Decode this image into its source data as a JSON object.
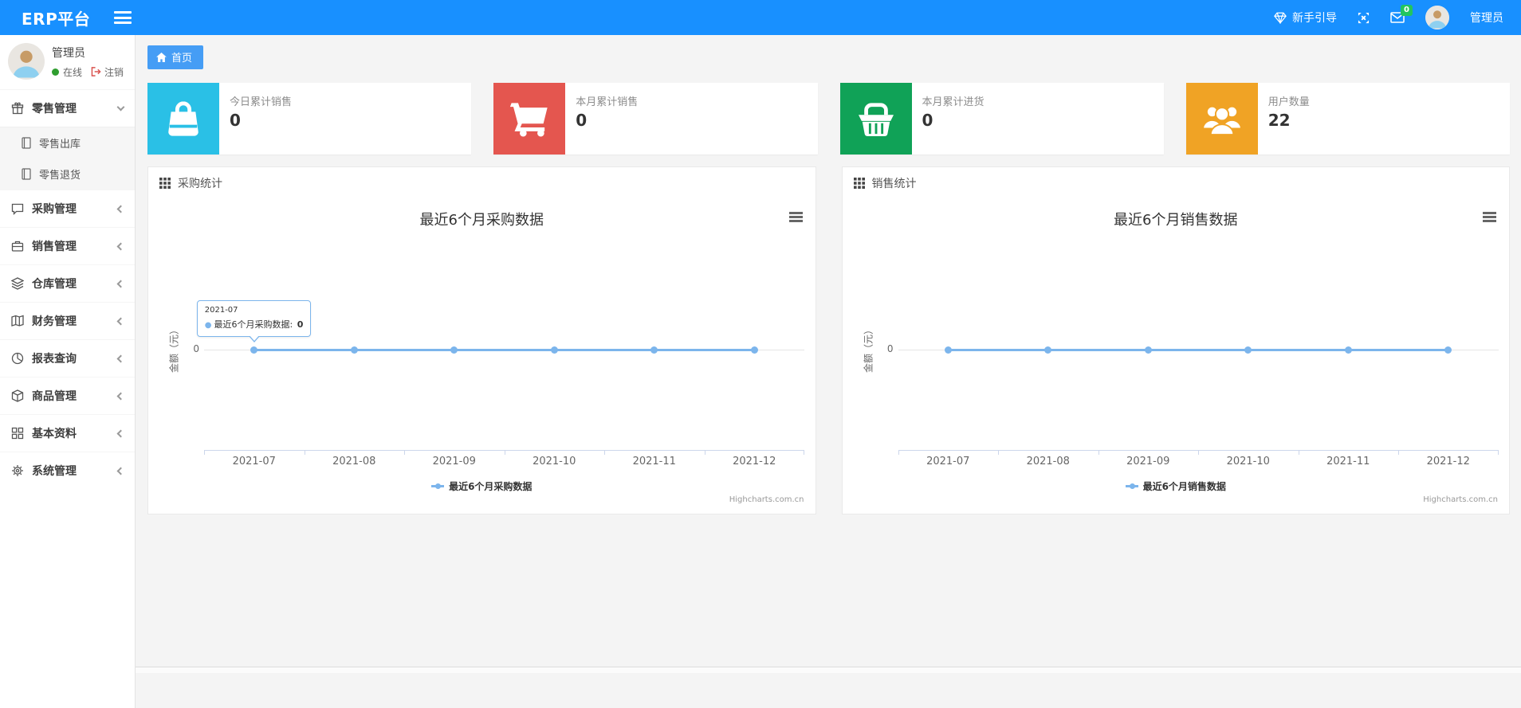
{
  "topbar": {
    "logo": "ERP平台",
    "guide": "新手引导",
    "badge": "0",
    "user": "管理员"
  },
  "sidebar": {
    "user": {
      "name": "管理员",
      "status": "在线",
      "logout": "注销"
    },
    "menu": [
      {
        "label": "零售管理",
        "icon": "gift-icon",
        "expanded": true,
        "children": [
          {
            "label": "零售出库",
            "icon": "journal-icon"
          },
          {
            "label": "零售退货",
            "icon": "journal-icon"
          }
        ]
      },
      {
        "label": "采购管理",
        "icon": "chat-icon"
      },
      {
        "label": "销售管理",
        "icon": "briefcase-icon"
      },
      {
        "label": "仓库管理",
        "icon": "layers-icon"
      },
      {
        "label": "财务管理",
        "icon": "ledger-icon"
      },
      {
        "label": "报表查询",
        "icon": "pie-chart-icon"
      },
      {
        "label": "商品管理",
        "icon": "package-icon"
      },
      {
        "label": "基本资料",
        "icon": "grid-icon"
      },
      {
        "label": "系统管理",
        "icon": "gear-icon"
      }
    ]
  },
  "tabs": [
    {
      "label": "首页",
      "active": true
    }
  ],
  "cards": [
    {
      "label": "今日累计销售",
      "value": "0",
      "color": "#2ac0e6",
      "icon": "shopping-bag-icon"
    },
    {
      "label": "本月累计销售",
      "value": "0",
      "color": "#e4564f",
      "icon": "cart-icon"
    },
    {
      "label": "本月累计进货",
      "value": "0",
      "color": "#10a257",
      "icon": "basket-icon"
    },
    {
      "label": "用户数量",
      "value": "22",
      "color": "#f0a325",
      "icon": "users-icon"
    }
  ],
  "panels": [
    {
      "title": "采购统计",
      "icon": "th-grid-icon"
    },
    {
      "title": "销售统计",
      "icon": "th-grid-icon"
    }
  ],
  "chart_data": [
    {
      "type": "line",
      "title": "最近6个月采购数据",
      "categories": [
        "2021-07",
        "2021-08",
        "2021-09",
        "2021-10",
        "2021-11",
        "2021-12"
      ],
      "series": [
        {
          "name": "最近6个月采购数据",
          "values": [
            0,
            0,
            0,
            0,
            0,
            0
          ]
        }
      ],
      "ylabel": "金额（元）",
      "yticks": [
        "0"
      ],
      "grid": true,
      "legend_position": "bottom",
      "line_color": "#7cb5ec",
      "credit": "Highcharts.com.cn",
      "tooltip": {
        "category": "2021-07",
        "series": "最近6个月采购数据",
        "value": "0"
      }
    },
    {
      "type": "line",
      "title": "最近6个月销售数据",
      "categories": [
        "2021-07",
        "2021-08",
        "2021-09",
        "2021-10",
        "2021-11",
        "2021-12"
      ],
      "series": [
        {
          "name": "最近6个月销售数据",
          "values": [
            0,
            0,
            0,
            0,
            0,
            0
          ]
        }
      ],
      "ylabel": "金额（元）",
      "yticks": [
        "0"
      ],
      "grid": true,
      "legend_position": "bottom",
      "line_color": "#7cb5ec",
      "credit": "Highcharts.com.cn",
      "tooltip": null
    }
  ]
}
